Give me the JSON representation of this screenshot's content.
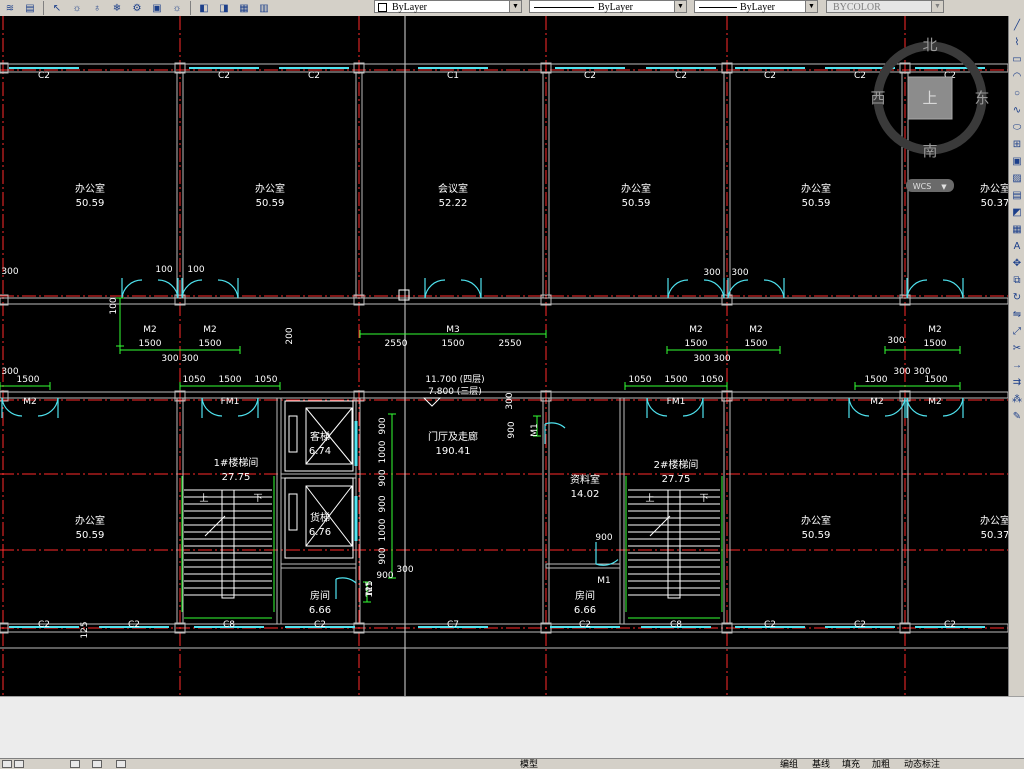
{
  "toolbar": {
    "icons": [
      "layers-icon",
      "layer-state-icon",
      "pointer-icon",
      "sun-icon",
      "lightbulb-icon",
      "layer-freeze-icon",
      "gear-icon",
      "layer-lock-icon",
      "sun-icon",
      "layer-prev-icon",
      "layer-iso-icon",
      "layer-copy-icon",
      "layer-off-icon"
    ],
    "color_combo": "ByLayer",
    "linetype_combo": "ByLayer",
    "lineweight_combo": "ByLayer",
    "plotstyle_combo": "BYCOLOR"
  },
  "viewcube": {
    "north": "北",
    "south": "南",
    "east": "东",
    "west": "西",
    "top": "上",
    "wcs": "WCS"
  },
  "plan": {
    "windows_top": [
      "C2",
      "C2",
      "C2",
      "C1",
      "C2",
      "C2",
      "C2",
      "C2",
      "C2"
    ],
    "windows_bottom": [
      "C2",
      "C2",
      "C8",
      "C2",
      "C7",
      "C2",
      "C8",
      "C2",
      "C2",
      "C2"
    ],
    "rooms": [
      {
        "name": "办公室",
        "area": "50.59"
      },
      {
        "name": "办公室",
        "area": "50.59"
      },
      {
        "name": "会议室",
        "area": "52.22"
      },
      {
        "name": "办公室",
        "area": "50.59"
      },
      {
        "name": "办公室",
        "area": "50.59"
      },
      {
        "name": "办公室",
        "area": "50.37"
      },
      {
        "name": "1#楼梯间",
        "area": "27.75"
      },
      {
        "name": "客梯",
        "area": "6.74"
      },
      {
        "name": "货梯",
        "area": "6.76"
      },
      {
        "name": "门厅及走廊",
        "area": "190.41"
      },
      {
        "name": "资料室",
        "area": "14.02"
      },
      {
        "name": "2#楼梯间",
        "area": "27.75"
      },
      {
        "name": "办公室",
        "area": "50.59"
      },
      {
        "name": "办公室",
        "area": "50.59"
      },
      {
        "name": "房间",
        "area": "6.66"
      },
      {
        "name": "房间",
        "area": "6.66"
      },
      {
        "name": "办公室",
        "area": "50.37"
      }
    ],
    "doors": [
      "M2",
      "M2",
      "M2",
      "M2",
      "M2",
      "M2",
      "M2",
      "FM1",
      "FM1",
      "M2",
      "M2",
      "M1",
      "M1",
      "M1",
      "M2",
      "M2",
      "M2",
      "M2"
    ],
    "dims": [
      "300",
      "100",
      "100",
      "100",
      "1500",
      "1500",
      "300 300",
      "200",
      "2550",
      "1500",
      "2550",
      "300",
      "300",
      "1500",
      "1500",
      "300 300",
      "300",
      "1500",
      "300",
      "1500",
      "1050",
      "1500",
      "1050",
      "1050",
      "1500",
      "1050",
      "1500",
      "300 300",
      "1500",
      "900",
      "1000",
      "900",
      "900",
      "1000",
      "900",
      "900",
      "300",
      "900",
      "900",
      "300",
      "125",
      "125"
    ],
    "elev_1": "11.700 (四层)",
    "elev_2": "7.800 (三层)",
    "stair_up": "上",
    "stair_down": "下",
    "center_door": "M3"
  },
  "palette": [
    "line-icon",
    "polyline-icon",
    "rectangle-icon",
    "arc-icon",
    "circle-icon",
    "spline-icon",
    "ellipse-icon",
    "insert-icon",
    "block-icon",
    "hatch-icon",
    "gradient-icon",
    "region-icon",
    "table-icon",
    "text-icon",
    "move-icon",
    "copy-icon",
    "rotate-icon",
    "mirror-icon",
    "scale-icon",
    "trim-icon",
    "extend-icon",
    "offset-icon",
    "array-icon",
    "erase-icon"
  ],
  "status": {
    "model_tab": "模型",
    "items": [
      "编组",
      "基线",
      "填充",
      "加粗",
      "动态标注"
    ]
  }
}
